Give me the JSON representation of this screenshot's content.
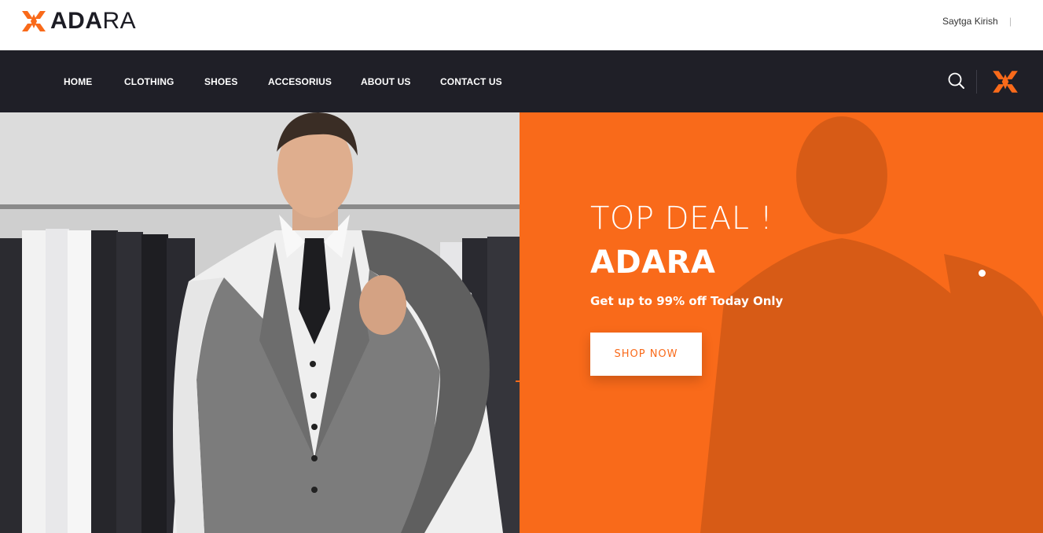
{
  "brand": {
    "logo_text_bold": "ADA",
    "logo_text_light": "RA",
    "logo_icon": "adara-x-logo-icon",
    "accent_color": "#f96a1a",
    "dark_color": "#1f1f27"
  },
  "header": {
    "user_name": "Saytga Kirish",
    "separator": "|"
  },
  "nav": {
    "items": [
      {
        "label": "HOME"
      },
      {
        "label": "CLOTHING"
      },
      {
        "label": "SHOES"
      },
      {
        "label": "ACCESORIUS"
      },
      {
        "label": "ABOUT US"
      },
      {
        "label": "CONTACT US"
      }
    ],
    "search_icon": "search-icon",
    "brand_icon": "adara-x-logo-icon"
  },
  "hero": {
    "title": "TOP DEAL !",
    "brand": "ADARA",
    "subtitle": "Get up to 99% off Today Only",
    "button_label": "SHOP NOW",
    "image_subject": "man in grey suit vest holding jacket in clothing store"
  }
}
